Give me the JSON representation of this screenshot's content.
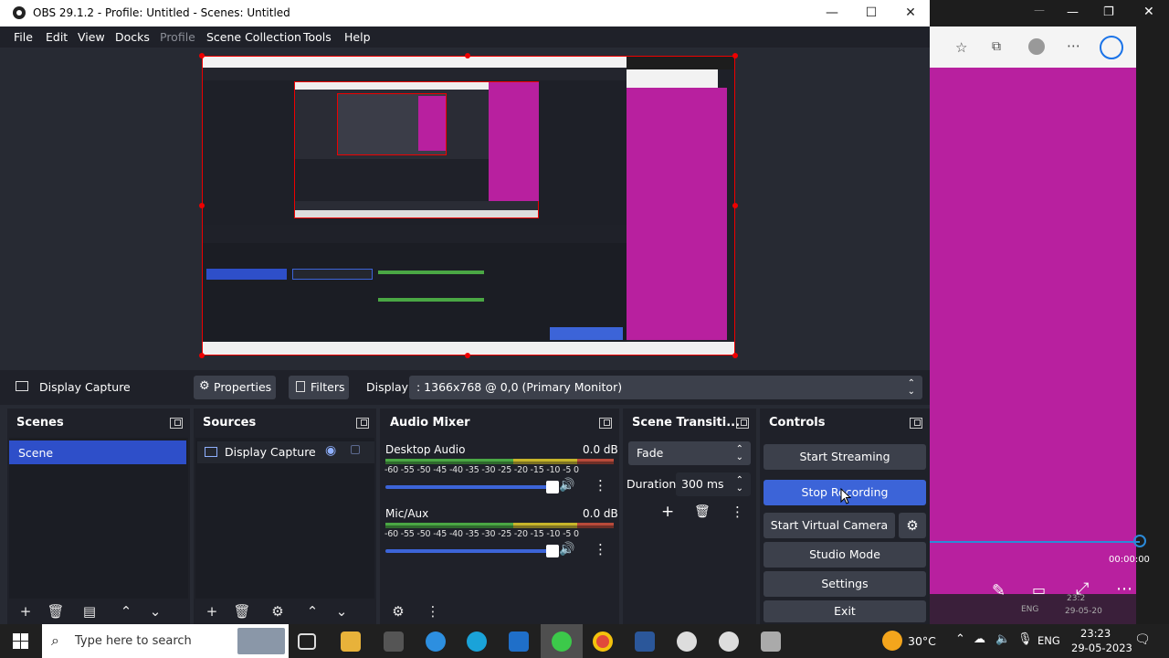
{
  "window": {
    "title": "OBS 29.1.2 - Profile: Untitled - Scenes: Untitled",
    "minimize": "—",
    "maximize": "☐",
    "close": "✕"
  },
  "menu": [
    "File",
    "Edit",
    "View",
    "Docks",
    "Profile",
    "Scene Collection",
    "Tools",
    "Help"
  ],
  "source_bar": {
    "source_name": "Display Capture",
    "properties": "Properties",
    "filters": "Filters",
    "display_label": "Display",
    "display_value": ": 1366x768 @ 0,0 (Primary Monitor)"
  },
  "scenes": {
    "title": "Scenes",
    "items": [
      "Scene"
    ]
  },
  "sources": {
    "title": "Sources",
    "items": [
      "Display Capture"
    ]
  },
  "audio_mixer": {
    "title": "Audio Mixer",
    "ticks": "-60 -55 -50 -45 -40 -35 -30 -25 -20 -15 -10  -5   0",
    "channels": [
      {
        "name": "Desktop Audio",
        "level": "0.0 dB"
      },
      {
        "name": "Mic/Aux",
        "level": "0.0 dB"
      }
    ]
  },
  "transitions": {
    "title": "Scene Transiti...",
    "selected": "Fade",
    "duration_label": "Duration",
    "duration_value": "300 ms"
  },
  "controls": {
    "title": "Controls",
    "start_streaming": "Start Streaming",
    "stop_recording": "Stop Recording",
    "start_virtual_camera": "Start Virtual Camera",
    "studio_mode": "Studio Mode",
    "settings": "Settings",
    "exit": "Exit"
  },
  "side_window": {
    "timestamp": "00:00:00",
    "tray_lang": "ENG",
    "tray_time": "23:2",
    "tray_date": "29-05-20"
  },
  "taskbar": {
    "search_placeholder": "Type here to search",
    "weather": "30°C",
    "lang": "ENG",
    "time": "23:23",
    "date": "29-05-2023"
  },
  "colors": {
    "accent": "#3c64d8",
    "selection": "#2e4fc9",
    "preview_border": "#ee0000",
    "magenta": "#b8209f"
  }
}
